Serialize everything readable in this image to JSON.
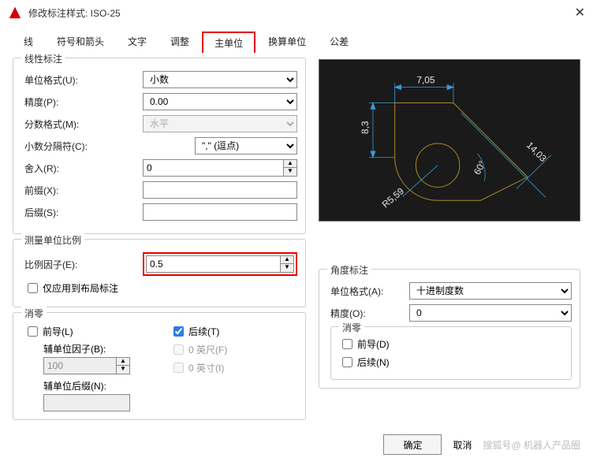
{
  "dialog": {
    "title": "修改标注样式: ISO-25"
  },
  "tabs": {
    "t0": "线",
    "t1": "符号和箭头",
    "t2": "文字",
    "t3": "调整",
    "t4": "主单位",
    "t5": "换算单位",
    "t6": "公差"
  },
  "linear": {
    "group_label": "线性标注",
    "unit_format_label": "单位格式(U):",
    "unit_format_value": "小数",
    "precision_label": "精度(P):",
    "precision_value": "0.00",
    "fraction_label": "分数格式(M):",
    "fraction_value": "水平",
    "decimal_sep_label": "小数分隔符(C):",
    "decimal_sep_value": "\",\"  (逗点)",
    "round_label": "舍入(R):",
    "round_value": "0",
    "prefix_label": "前缀(X):",
    "prefix_value": "",
    "suffix_label": "后缀(S):",
    "suffix_value": ""
  },
  "scale": {
    "group_label": "测量单位比例",
    "factor_label": "比例因子(E):",
    "factor_value": "0.5",
    "layout_only_label": "仅应用到布局标注"
  },
  "zero_left": {
    "group_label": "消零",
    "leading_label": "前导(L)",
    "trailing_label": "后续(T)",
    "aux_factor_label": "辅单位因子(B):",
    "aux_factor_value": "100",
    "aux_suffix_label": "辅单位后缀(N):",
    "aux_suffix_value": "",
    "feet_label": "0 英尺(F)",
    "inch_label": "0 英寸(I)"
  },
  "angular": {
    "group_label": "角度标注",
    "unit_format_label": "单位格式(A):",
    "unit_format_value": "十进制度数",
    "precision_label": "精度(O):",
    "precision_value": "0",
    "zero_group_label": "消零",
    "leading_label": "前导(D)",
    "trailing_label": "后续(N)"
  },
  "buttons": {
    "ok": "确定",
    "cancel": "取消"
  },
  "watermark": "搜狐号@ 机器人产品圈",
  "preview": {
    "dim_top": "7,05",
    "dim_left": "8,3",
    "dim_radius": "R5,59",
    "dim_angle": "60°",
    "dim_right": "14,03"
  }
}
